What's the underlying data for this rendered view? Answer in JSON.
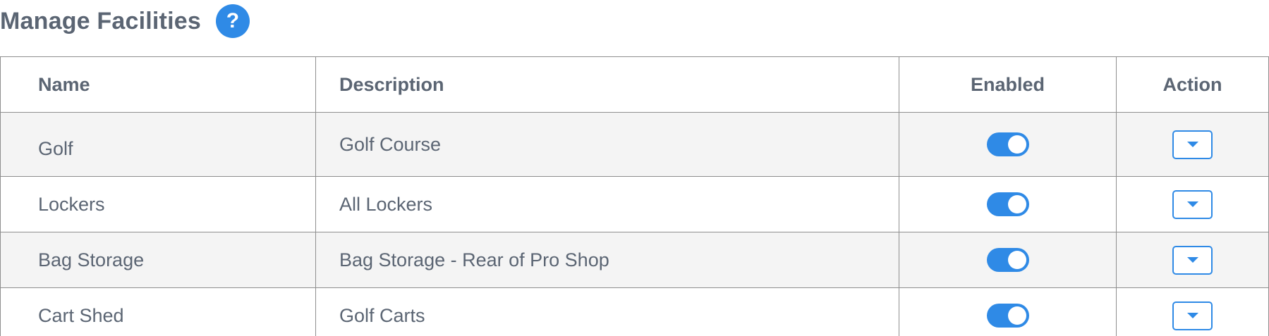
{
  "header": {
    "title": "Manage Facilities",
    "help_label": "?"
  },
  "table": {
    "columns": {
      "name": "Name",
      "description": "Description",
      "enabled": "Enabled",
      "action": "Action"
    },
    "rows": [
      {
        "name": "Golf",
        "description": "Golf Course",
        "enabled": true
      },
      {
        "name": "Lockers",
        "description": "All Lockers",
        "enabled": true
      },
      {
        "name": "Bag Storage",
        "description": "Bag Storage - Rear of Pro Shop",
        "enabled": true
      },
      {
        "name": "Cart Shed",
        "description": "Golf Carts",
        "enabled": true
      }
    ]
  },
  "icons": {
    "help": "question-mark-icon",
    "action": "caret-down-icon"
  },
  "colors": {
    "accent": "#2f8ae6",
    "text": "#5b6573",
    "row_stripe": "#f4f4f4",
    "border": "#8e8e8e"
  }
}
